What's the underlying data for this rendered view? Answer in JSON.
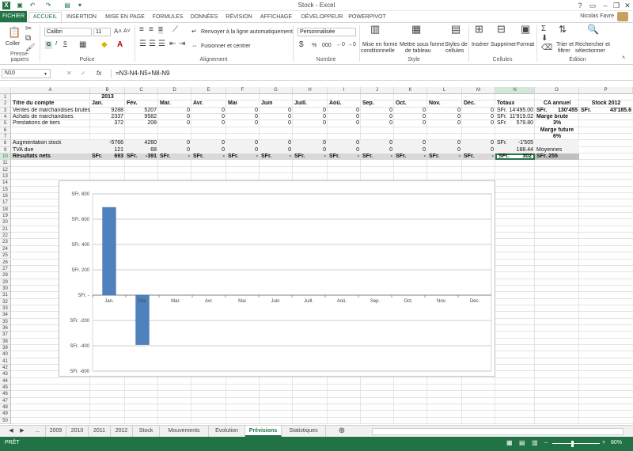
{
  "window": {
    "title": "Stock - Excel",
    "user": "Nicolas Favre"
  },
  "tabs": [
    "FICHIER",
    "ACCUEIL",
    "INSERTION",
    "MISE EN PAGE",
    "FORMULES",
    "DONNÉES",
    "RÉVISION",
    "AFFICHAGE",
    "DÉVELOPPEUR",
    "POWERPIVOT"
  ],
  "ribbon": {
    "clipboard": {
      "paste": "Coller",
      "label": "Presse-papiers"
    },
    "font": {
      "name": "Calibri",
      "size": "11",
      "label": "Police",
      "bold": "G",
      "italic": "I",
      "underline": "S"
    },
    "alignment": {
      "wrap": "Renvoyer à la ligne automatiquement",
      "merge": "Fusionner et centrer",
      "label": "Alignement"
    },
    "number": {
      "format": "Personnalisée",
      "label": "Nombre",
      "percent": "%",
      "thousands": "000"
    },
    "styles": {
      "cond1": "Mise en forme",
      "cond2": "conditionnelle",
      "table1": "Mettre sous forme",
      "table2": "de tableau",
      "cell1": "Styles de",
      "cell2": "cellules",
      "label": "Style"
    },
    "cells": {
      "insert": "Insérer",
      "delete": "Supprimer",
      "format": "Format",
      "label": "Cellules"
    },
    "editing": {
      "sort1": "Trier et",
      "sort2": "filtrer",
      "find1": "Rechercher et",
      "find2": "sélectionner",
      "label": "Édition"
    }
  },
  "formula_bar": {
    "name_box": "N10",
    "fx": "fx",
    "formula": "=N3-N4-N5+N8-N9"
  },
  "columns": [
    "A",
    "B",
    "C",
    "D",
    "E",
    "F",
    "G",
    "H",
    "I",
    "J",
    "K",
    "L",
    "M",
    "N",
    "O",
    "P"
  ],
  "rows": [
    "1",
    "2",
    "3",
    "4",
    "5",
    "6",
    "7",
    "8",
    "9",
    "10",
    "11",
    "12",
    "13",
    "14",
    "15",
    "16",
    "17",
    "18",
    "19",
    "20",
    "21",
    "22",
    "23",
    "24",
    "25",
    "26",
    "27",
    "28",
    "29",
    "30",
    "31",
    "32",
    "33",
    "34",
    "35",
    "36",
    "37",
    "38",
    "39",
    "40",
    "41",
    "42",
    "43",
    "44",
    "45",
    "46",
    "47",
    "48",
    "49",
    "50"
  ],
  "cells": {
    "B1": "2013",
    "A2": "Titre du compte",
    "B2": "Jan.",
    "C2": "Fév.",
    "D2": "Mar.",
    "E2": "Avr.",
    "F2": "Mai",
    "G2": "Juin",
    "H2": "Juill.",
    "I2": "Aoû.",
    "J2": "Sep.",
    "K2": "Oct.",
    "L2": "Nov.",
    "M2": "Déc.",
    "N2": "Totaux",
    "O2": "CA annuel",
    "P2": "Stock 2012",
    "A3": "Ventes de marchandises brutes",
    "B3": "9288",
    "C3": "5207",
    "N3a": "SFr.",
    "N3b": "14'495.00",
    "O3a": "SFr.",
    "O3b": "130'455",
    "P3a": "SFr.",
    "P3b": "43'185.6",
    "A4": "Achats de marchandises",
    "B4": "2337",
    "C4": "9582",
    "N4a": "SFr.",
    "N4b": "11'919.02",
    "O4": "Marge brute",
    "A5": "Prestations de tiers",
    "B5": "372",
    "C5": "208",
    "N5a": "SFr.",
    "N5b": "579.80",
    "O5": "3%",
    "O6": "Marge future",
    "O7": "6%",
    "A8": "Augmentation stock",
    "B8": "-5766",
    "C8": "4260",
    "N8a": "SFr.",
    "N8b": "-1'505",
    "A9": "TVA due",
    "B9": "121",
    "C9": "68",
    "N9": "188.44",
    "O9": "Moyennes",
    "A10": "Résultats nets",
    "B10a": "SFr.",
    "B10b": "693",
    "C10a": "SFr.",
    "C10b": "-391",
    "D10": "SFr.",
    "D10b": "-",
    "N10a": "SFr.",
    "N10b": "302",
    "O10": "SFr. 255"
  },
  "zeros": "0",
  "chart_data": {
    "type": "bar",
    "categories": [
      "Jan.",
      "Fév.",
      "Mar.",
      "Avr.",
      "Mai",
      "Juin",
      "Juill.",
      "Aoû.",
      "Sep.",
      "Oct.",
      "Nov.",
      "Déc."
    ],
    "values": [
      693,
      -391,
      0,
      0,
      0,
      0,
      0,
      0,
      0,
      0,
      0,
      0
    ],
    "ylim": [
      -600,
      800
    ],
    "yticks": [
      800,
      600,
      400,
      200,
      0,
      -200,
      -400,
      -600
    ],
    "ytick_labels": [
      "SFr. 800",
      "SFr. 600",
      "SFr. 400",
      "SFr. 200",
      "SFr. -",
      "SFr. -200",
      "SFr. -400",
      "SFr. -600"
    ],
    "bar_color": "#4f81bd",
    "grid": true,
    "legend": false
  },
  "sheets": [
    "...",
    "2009",
    "2010",
    "2011",
    "2012",
    "Stock",
    "Mouvements",
    "Evolution",
    "Prévisions",
    "Statistiques"
  ],
  "active_sheet": "Prévisions",
  "status": {
    "mode": "PRÊT",
    "zoom": "80%"
  },
  "colors": {
    "accent": "#217346",
    "bar": "#4f81bd"
  }
}
